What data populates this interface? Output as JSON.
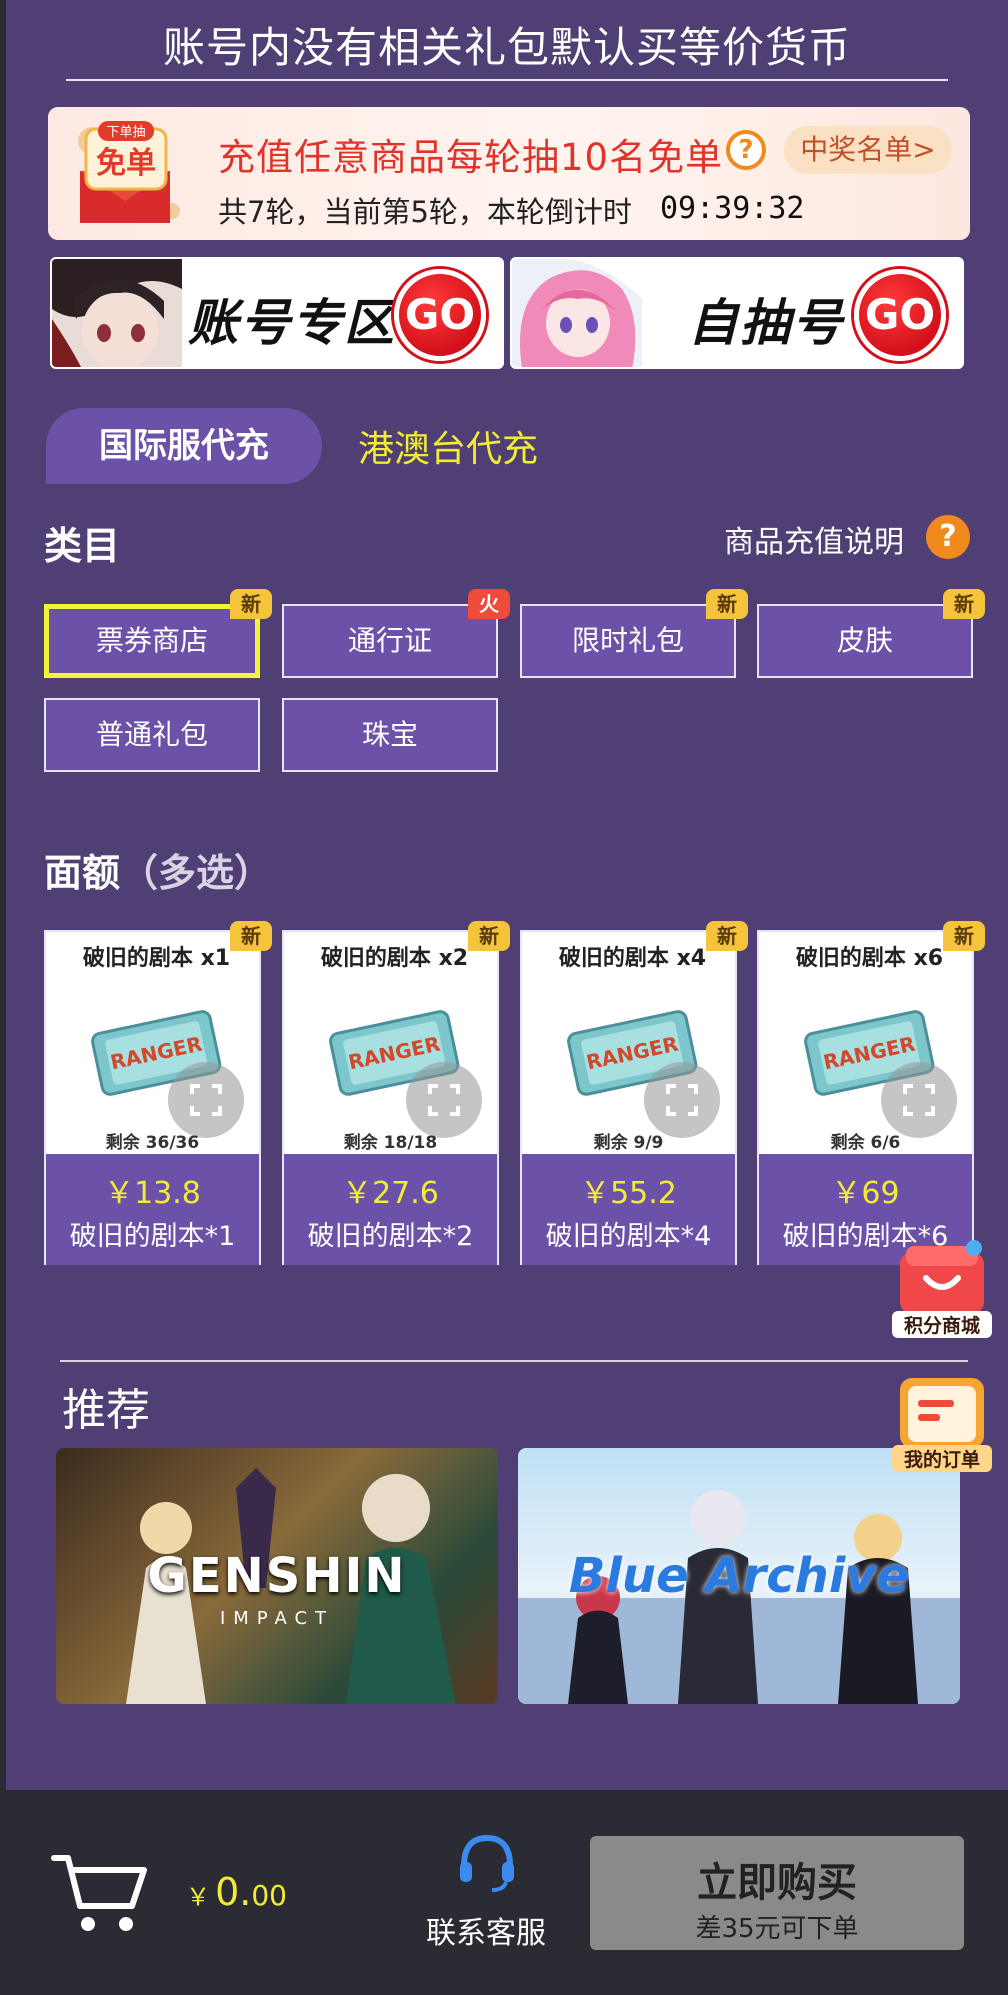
{
  "header": {
    "title": "账号内没有相关礼包默认买等价货币"
  },
  "promo": {
    "badge_top": "下单抽",
    "badge_main": "免单",
    "title": "充值任意商品每轮抽10名免单",
    "help": "?",
    "winners_link": "中奖名单>",
    "subtitle": "共7轮，当前第5轮，本轮倒计时",
    "timer": "09:39:32"
  },
  "zones": [
    {
      "label": "账号专区",
      "go": "GO"
    },
    {
      "label": "自抽号",
      "go": "GO"
    }
  ],
  "server_tabs": [
    {
      "label": "国际服代充",
      "active": true
    },
    {
      "label": "港澳台代充",
      "active": false
    }
  ],
  "category_section": {
    "title": "类目",
    "note": "商品充值说明",
    "help": "?"
  },
  "categories": [
    {
      "label": "票券商店",
      "badge": "新",
      "badge_type": "new",
      "selected": true
    },
    {
      "label": "通行证",
      "badge": "火",
      "badge_type": "hot",
      "selected": false
    },
    {
      "label": "限时礼包",
      "badge": "新",
      "badge_type": "new",
      "selected": false
    },
    {
      "label": "皮肤",
      "badge": "新",
      "badge_type": "new",
      "selected": false
    },
    {
      "label": "普通礼包",
      "badge": "",
      "badge_type": "",
      "selected": false
    },
    {
      "label": "珠宝",
      "badge": "",
      "badge_type": "",
      "selected": false
    }
  ],
  "denomination_section": {
    "title": "面额",
    "subtitle": "（多选）"
  },
  "products": [
    {
      "name": "破旧的剧本 x1",
      "badge": "新",
      "stock": "剩余 36/36",
      "price": "￥13.8",
      "label": "破旧的剧本*1"
    },
    {
      "name": "破旧的剧本 x2",
      "badge": "新",
      "stock": "剩余 18/18",
      "price": "￥27.6",
      "label": "破旧的剧本*2"
    },
    {
      "name": "破旧的剧本 x4",
      "badge": "新",
      "stock": "剩余 9/9",
      "price": "￥55.2",
      "label": "破旧的剧本*4"
    },
    {
      "name": "破旧的剧本 x6",
      "badge": "新",
      "stock": "剩余 6/6",
      "price": "￥69",
      "label": "破旧的剧本*6"
    }
  ],
  "recommend": {
    "title": "推荐",
    "items": [
      {
        "label": "GENSHIN",
        "sub": "IMPACT"
      },
      {
        "label": "Blue Archive",
        "sub": ""
      }
    ]
  },
  "floating": {
    "points_mall": "积分商城",
    "my_orders": "我的订单"
  },
  "bottom_bar": {
    "currency": "￥",
    "total_int": "0.",
    "total_dec": "00",
    "support_label": "联系客服",
    "buy_label": "立即购买",
    "buy_sub": "差35元可下单"
  },
  "colors": {
    "page_bg": "#4f3f74",
    "accent_purple": "#6b52a8",
    "highlight_yellow": "#f3ec35",
    "go_red": "#d4101a",
    "badge_new": "#f5c43a",
    "badge_hot": "#ee4b3b",
    "bottom_bar": "#2b2b33",
    "buy_disabled": "#8a8a8a"
  }
}
